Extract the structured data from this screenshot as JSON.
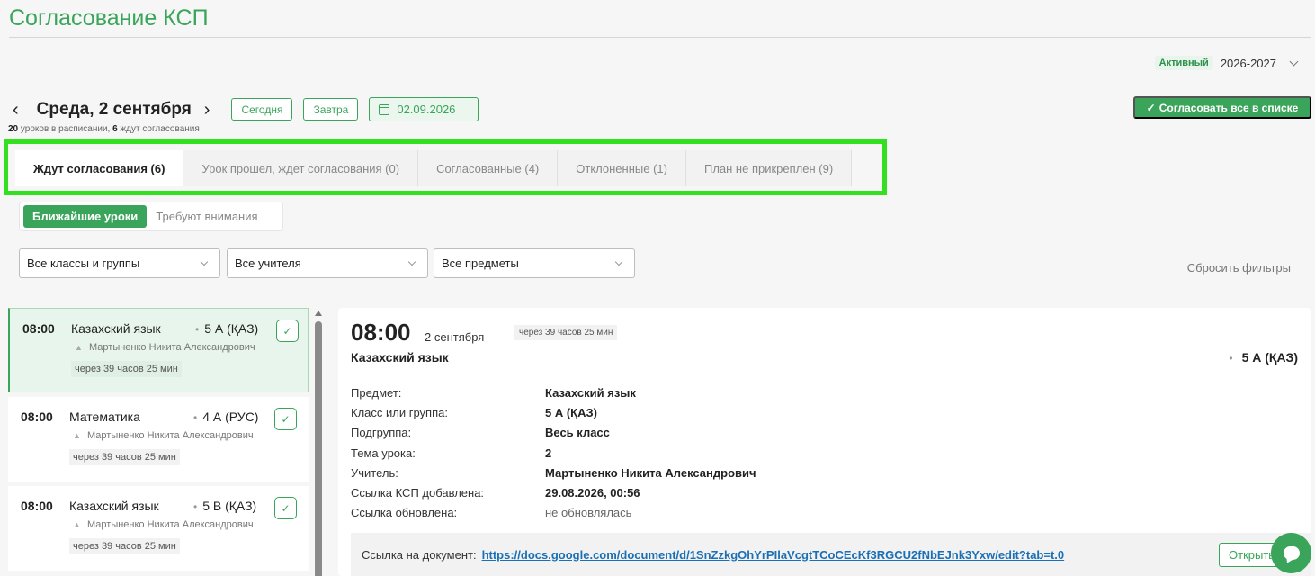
{
  "header": {
    "title": "Согласование КСП",
    "active_badge": "Активный",
    "year": "2026-2027"
  },
  "date_nav": {
    "prev_icon": "chevron-left-icon",
    "next_icon": "chevron-right-icon",
    "prev_glyph": "‹",
    "next_glyph": "›",
    "title": "Среда, 2 сентября",
    "today_label": "Сегодня",
    "tomorrow_label": "Завтра",
    "date_value": "02.09.2026",
    "info_count": "20",
    "info_text1": " уроков в расписании, ",
    "info_waiting": "6",
    "info_text2": " ждут согласования"
  },
  "approve_all": {
    "check": "✓",
    "label": "Согласовать все в списке"
  },
  "tabs": [
    {
      "label": "Ждут согласования (6)",
      "active": true
    },
    {
      "label": "Урок прошел, ждет согласования (0)"
    },
    {
      "label": "Согласованные (4)"
    },
    {
      "label": "Отклоненные (1)"
    },
    {
      "label": "План не прикреплен (9)"
    }
  ],
  "segment": {
    "nearest": "Ближайшие уроки",
    "attention": "Требуют внимания"
  },
  "filters": {
    "classes": "Все классы и группы",
    "teachers": "Все учителя",
    "subjects": "Все предметы",
    "reset": "Сбросить фильтры"
  },
  "lessons": [
    {
      "time": "08:00",
      "subject": "Казахский язык",
      "class": "5 А (ҚАЗ)",
      "teacher": "Мартыненко Никита Александрович",
      "when": "через 39 часов 25 мин",
      "selected": true
    },
    {
      "time": "08:00",
      "subject": "Математика",
      "class": "4 А (РУС)",
      "teacher": "Мартыненко Никита Александрович",
      "when": "через 39 часов 25 мин"
    },
    {
      "time": "08:00",
      "subject": "Казахский язык",
      "class": "5 В (ҚАЗ)",
      "teacher": "Мартыненко Никита Александрович",
      "when": "через 39 часов 25 мин"
    }
  ],
  "detail": {
    "time": "08:00",
    "date": "2 сентября",
    "when": "через 39 часов 25 мин",
    "subject": "Казахский язык",
    "class": "5 А (ҚАЗ)",
    "rows": [
      {
        "k": "Предмет:",
        "v": "Казахский язык"
      },
      {
        "k": "Класс или группа:",
        "v": "5 А (ҚАЗ)"
      },
      {
        "k": "Подгруппа:",
        "v": "Весь класс"
      },
      {
        "k": "Тема урока:",
        "v": "2"
      },
      {
        "k": "Учитель:",
        "v": "Мартыненко Никита Александрович"
      },
      {
        "k": "Ссылка КСП добавлена:",
        "v": "29.08.2026, 00:56"
      },
      {
        "k": "Ссылка обновлена:",
        "v": "не обновлялась"
      }
    ],
    "link_label": "Ссылка на документ:",
    "link_url": "https://docs.google.com/document/d/1SnZzkgOhYrPIlaVcgtTCoCEcKf3RGCU2fNbEJnk3Yxw/edit?tab=t.0",
    "open_label": "Открыть"
  },
  "colors": {
    "accent": "#3aa55a",
    "highlight_frame": "#33e01f",
    "link": "#1a6fb5"
  }
}
